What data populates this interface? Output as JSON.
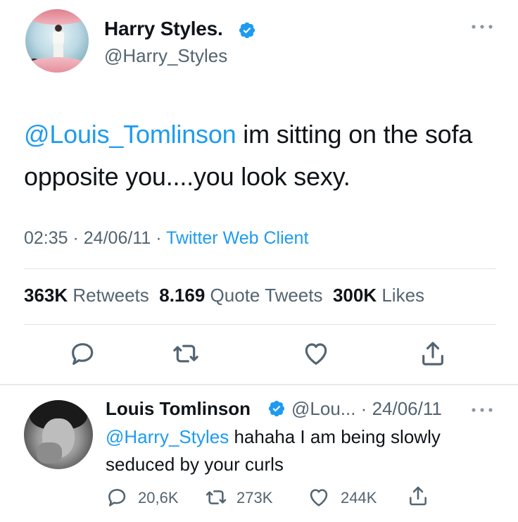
{
  "tweet": {
    "author_name": "Harry Styles.",
    "author_handle": "@Harry_Styles",
    "mention": "@Louis_Tomlinson",
    "text": " im sitting on the sofa opposite you....you look sexy.",
    "time": "02:35",
    "date": "24/06/11",
    "client": "Twitter Web Client",
    "separator": " · ",
    "stats": {
      "retweets_count": "363K",
      "retweets_label": "Retweets",
      "quotes_count": "8.169",
      "quotes_label": "Quote Tweets",
      "likes_count": "300K",
      "likes_label": "Likes"
    },
    "actions": [
      "reply-icon",
      "retweet-icon",
      "like-icon",
      "share-icon"
    ]
  },
  "reply": {
    "author_name": "Louis Tomlinson",
    "author_handle": "@Lou...",
    "date": "24/06/11",
    "separator": " · ",
    "mention": "@Harry_Styles",
    "text": " hahaha I am being slowly seduced by your curls",
    "counts": {
      "replies": "20,6K",
      "retweets": "273K",
      "likes": "244K"
    }
  },
  "colors": {
    "accent": "#1d9bf0",
    "secondary_text": "#536471",
    "primary_text": "#0f1419",
    "divider": "#e1e5e8"
  }
}
